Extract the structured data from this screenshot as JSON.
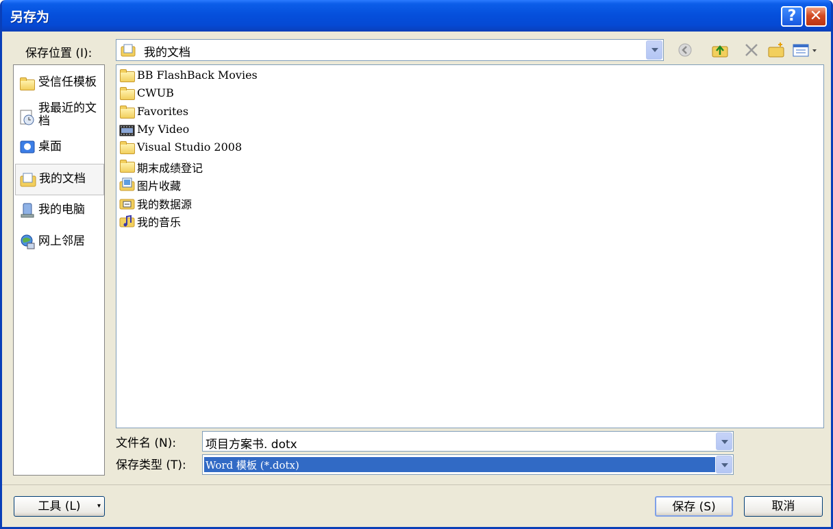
{
  "window": {
    "title": "另存为"
  },
  "titlebar": {
    "help_glyph": "?",
    "close_glyph": "✕"
  },
  "location": {
    "label": "保存位置 (I):",
    "value": "我的文档"
  },
  "places": [
    {
      "label": "受信任模板",
      "icon": "folder-icon"
    },
    {
      "label": "我最近的文档",
      "icon": "recent-documents-icon"
    },
    {
      "label": "桌面",
      "icon": "desktop-icon"
    },
    {
      "label": "我的文档",
      "icon": "my-documents-icon"
    },
    {
      "label": "我的电脑",
      "icon": "my-computer-icon"
    },
    {
      "label": "网上邻居",
      "icon": "network-places-icon"
    }
  ],
  "files": [
    {
      "name": "BB FlashBack Movies",
      "icon": "folder-icon"
    },
    {
      "name": "CWUB",
      "icon": "folder-icon"
    },
    {
      "name": "Favorites",
      "icon": "folder-icon"
    },
    {
      "name": "My Video",
      "icon": "video-folder-icon"
    },
    {
      "name": "Visual Studio 2008",
      "icon": "folder-icon"
    },
    {
      "name": "期末成绩登记",
      "icon": "folder-icon"
    },
    {
      "name": "图片收藏",
      "icon": "pictures-folder-icon"
    },
    {
      "name": "我的数据源",
      "icon": "data-sources-folder-icon"
    },
    {
      "name": "我的音乐",
      "icon": "music-folder-icon"
    }
  ],
  "filename": {
    "label": "文件名 (N):",
    "value": "项目方案书. dotx"
  },
  "filetype": {
    "label": "保存类型 (T):",
    "value": "Word 模板  (*.dotx)"
  },
  "buttons": {
    "tools": "工具 (L)",
    "save": "保存 (S)",
    "cancel": "取消"
  },
  "colors": {
    "titlebar": "#0550dc",
    "selection": "#316ac5",
    "dialog_bg": "#ece9d8"
  }
}
